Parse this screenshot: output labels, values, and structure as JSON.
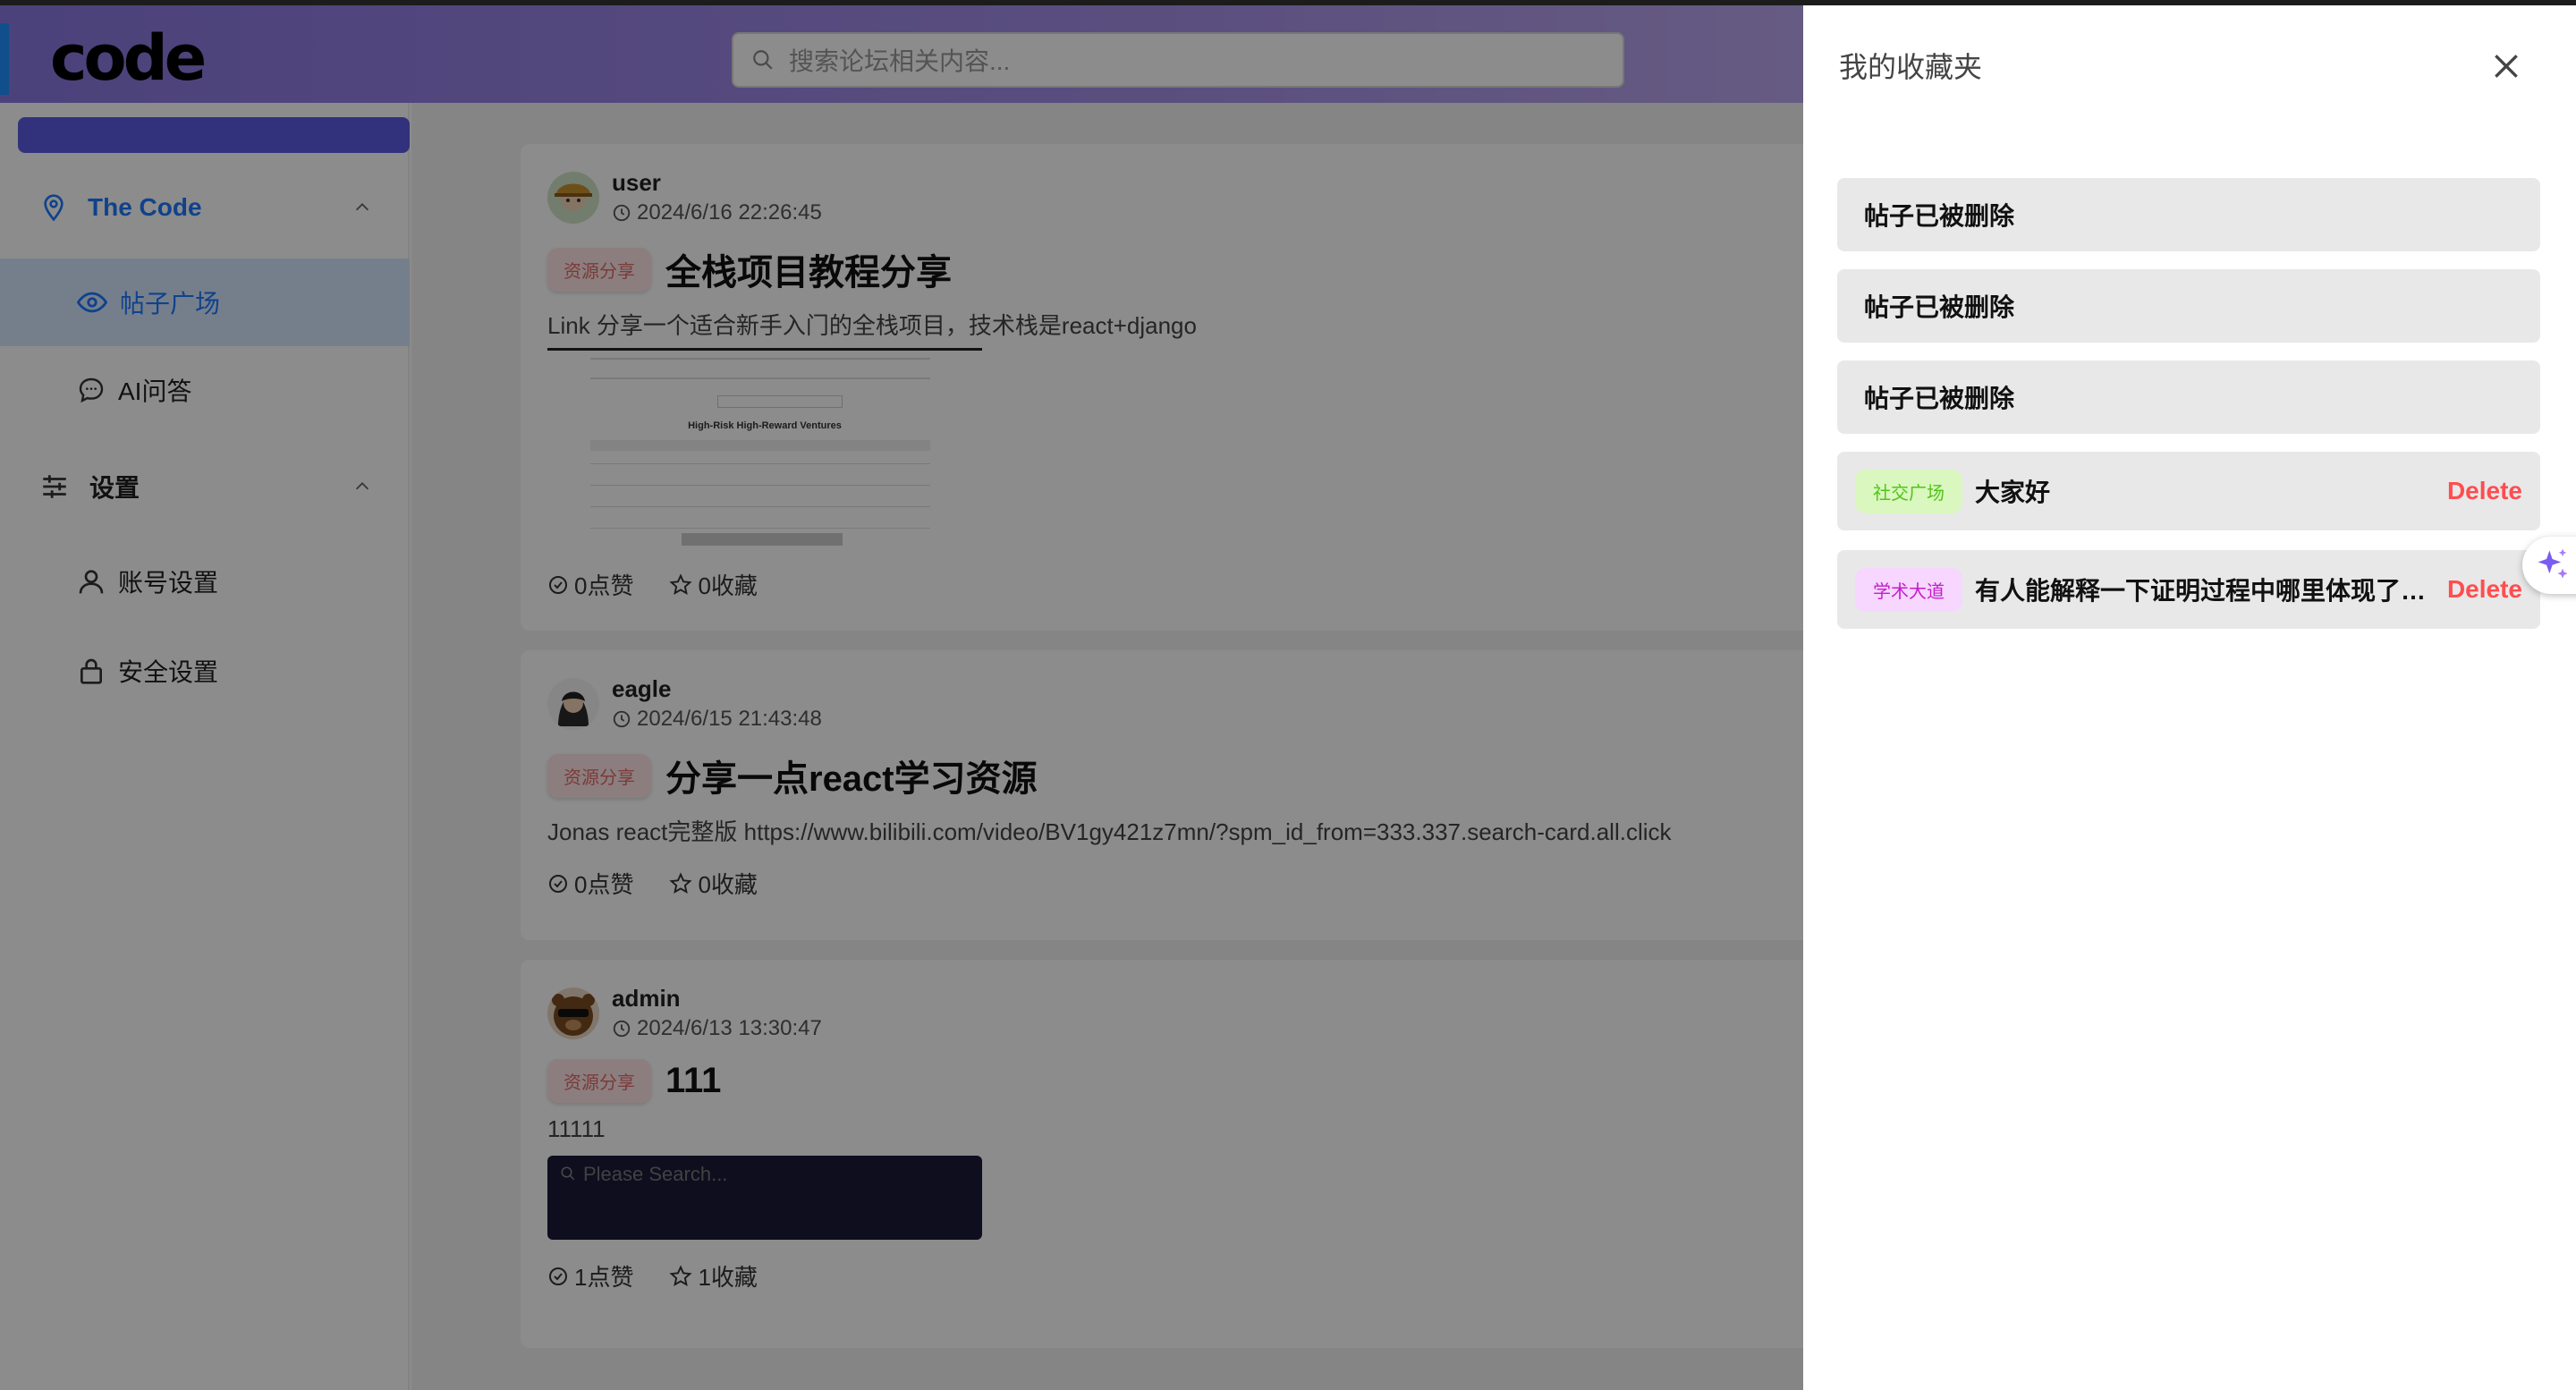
{
  "header": {
    "logo": "code",
    "search_placeholder": "搜索论坛相关内容..."
  },
  "sidebar": {
    "group1_label": "The Code",
    "items": [
      {
        "label": "帖子广场"
      },
      {
        "label": "AI问答"
      }
    ],
    "group2_label": "设置",
    "settings": [
      {
        "label": "账号设置"
      },
      {
        "label": "安全设置"
      }
    ]
  },
  "posts": [
    {
      "user": "user",
      "time": "2024/6/16 22:26:45",
      "tag": "资源分享",
      "title": "全栈项目教程分享",
      "body": "Link 分享一个适合新手入门的全栈项目，技术栈是react+django",
      "image_caption": "High-Risk High-Reward Ventures",
      "likes": "0点赞",
      "favs": "0收藏"
    },
    {
      "user": "eagle",
      "time": "2024/6/15 21:43:48",
      "tag": "资源分享",
      "title": "分享一点react学习资源",
      "body": "Jonas react完整版 https://www.bilibili.com/video/BV1gy421z7mn/?spm_id_from=333.337.search-card.all.click",
      "likes": "0点赞",
      "favs": "0收藏"
    },
    {
      "user": "admin",
      "time": "2024/6/13 13:30:47",
      "tag": "资源分享",
      "title": "111",
      "body": "11111",
      "image_placeholder": "Please Search...",
      "likes": "1点赞",
      "favs": "1收藏"
    }
  ],
  "drawer": {
    "title": "我的收藏夹",
    "items": [
      {
        "text": "帖子已被删除"
      },
      {
        "text": "帖子已被删除"
      },
      {
        "text": "帖子已被删除"
      },
      {
        "tag": "社交广场",
        "text": "大家好",
        "delete": "Delete"
      },
      {
        "tag": "学术大道",
        "text": "有人能解释一下证明过程中哪里体现了对称性吗？",
        "delete": "Delete"
      }
    ]
  },
  "colors": {
    "accent": "#1e78ff",
    "brand_gradient_start": "#8a78e0",
    "delete": "#ff4d4f",
    "tag_social_bg": "#d9f7be",
    "tag_social_fg": "#52c41a",
    "tag_academic_bg": "#f7d6ff",
    "tag_academic_fg": "#c41dcc"
  }
}
